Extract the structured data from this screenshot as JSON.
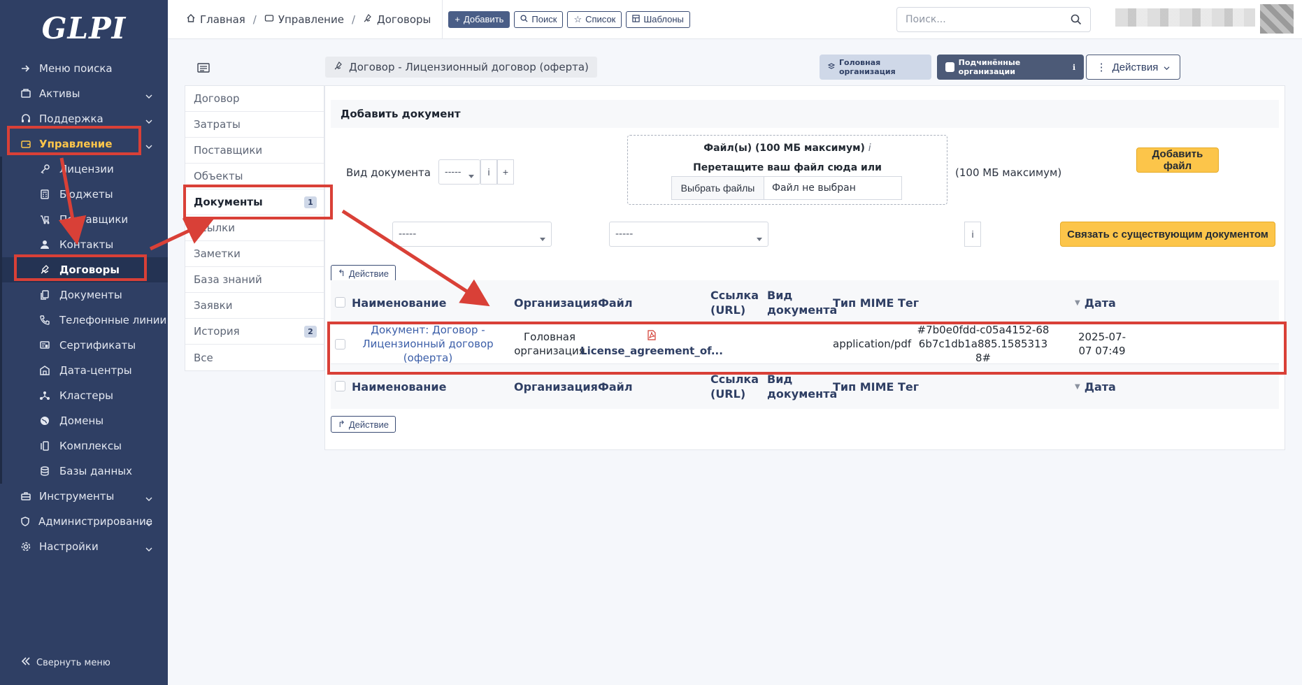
{
  "app": {
    "logo": "GLPI"
  },
  "sidebar": {
    "items": [
      {
        "label": "Меню поиска",
        "icon": "arrow-right-icon",
        "expandable": false
      },
      {
        "label": "Активы",
        "icon": "package-icon",
        "expandable": true
      },
      {
        "label": "Поддержка",
        "icon": "headset-icon",
        "expandable": true
      },
      {
        "label": "Управление",
        "icon": "wallet-icon",
        "expandable": true,
        "active": true
      }
    ],
    "sub_items": [
      {
        "label": "Лицензии",
        "icon": "key-icon"
      },
      {
        "label": "Бюджеты",
        "icon": "calculator-icon"
      },
      {
        "label": "Поставщики",
        "icon": "truck-icon"
      },
      {
        "label": "Контакты",
        "icon": "user-icon"
      },
      {
        "label": "Договоры",
        "icon": "contract-icon",
        "current": true
      },
      {
        "label": "Документы",
        "icon": "files-icon"
      },
      {
        "label": "Телефонные линии",
        "icon": "phone-icon"
      },
      {
        "label": "Сертификаты",
        "icon": "certificate-icon"
      },
      {
        "label": "Дата-центры",
        "icon": "building-icon"
      },
      {
        "label": "Кластеры",
        "icon": "cluster-icon"
      },
      {
        "label": "Домены",
        "icon": "globe-icon"
      },
      {
        "label": "Комплексы",
        "icon": "stack-icon"
      },
      {
        "label": "Базы данных",
        "icon": "database-icon"
      }
    ],
    "bottom_items": [
      {
        "label": "Инструменты",
        "icon": "briefcase-icon"
      },
      {
        "label": "Администрирование",
        "icon": "shield-icon"
      },
      {
        "label": "Настройки",
        "icon": "gear-icon"
      }
    ],
    "collapse_label": "Свернуть меню"
  },
  "topbar": {
    "breadcrumbs": [
      "Главная",
      "Управление",
      "Договоры"
    ],
    "buttons": {
      "add": "Добавить",
      "search": "Поиск",
      "list": "Список",
      "templates": "Шаблоны"
    },
    "search_placeholder": "Поиск..."
  },
  "header": {
    "title": "Договор - Лицензионный договор (оферта)",
    "entity_head": "Головная организация",
    "entity_subs": "Подчинённые организации",
    "actions_label": "Действия"
  },
  "tabs": [
    {
      "label": "Договор"
    },
    {
      "label": "Затраты"
    },
    {
      "label": "Поставщики"
    },
    {
      "label": "Объекты"
    },
    {
      "label": "Документы",
      "badge": "1",
      "active": true
    },
    {
      "label": "Ссылки"
    },
    {
      "label": "Заметки"
    },
    {
      "label": "База знаний"
    },
    {
      "label": "Заявки"
    },
    {
      "label": "История",
      "badge": "2"
    },
    {
      "label": "Все"
    }
  ],
  "add_document": {
    "heading": "Добавить документ",
    "doc_type_label": "Вид документа",
    "doc_type_value": "-----",
    "info_glyph": "i",
    "plus_glyph": "+",
    "dropzone_title": "Файл(ы) (100 МБ максимум)",
    "dropzone_hint": "Перетащите ваш файл сюда или",
    "choose_files": "Выбрать файлы",
    "no_file": "Файл не выбран",
    "max_size": "(100 МБ максимум)",
    "add_file_button": "Добавить файл",
    "select_1": "-----",
    "select_2": "-----",
    "link_button": "Связать с существующим документом"
  },
  "table": {
    "action_label": "Действие",
    "headers": [
      "Наименование",
      "Организация",
      "Файл",
      "Ссылка (URL)",
      "Вид документа",
      "Тип MIME",
      "Тег",
      "Дата"
    ],
    "sort_glyph": "▼",
    "rows": [
      {
        "name": "Документ: Договор - Лицензионный договор (оферта)",
        "entity": "Головная организация",
        "file": "License_agreement_of...",
        "url": "",
        "type": "",
        "mime": "application/pdf",
        "tag": "#7b0e0fdd-c05a4152-686b7c1db1a885.15853138#",
        "date": "2025-07-07 07:49"
      }
    ]
  },
  "colors": {
    "sidebar": "#2f3f64",
    "accent": "#fcc54a",
    "highlight": "#d94037"
  }
}
